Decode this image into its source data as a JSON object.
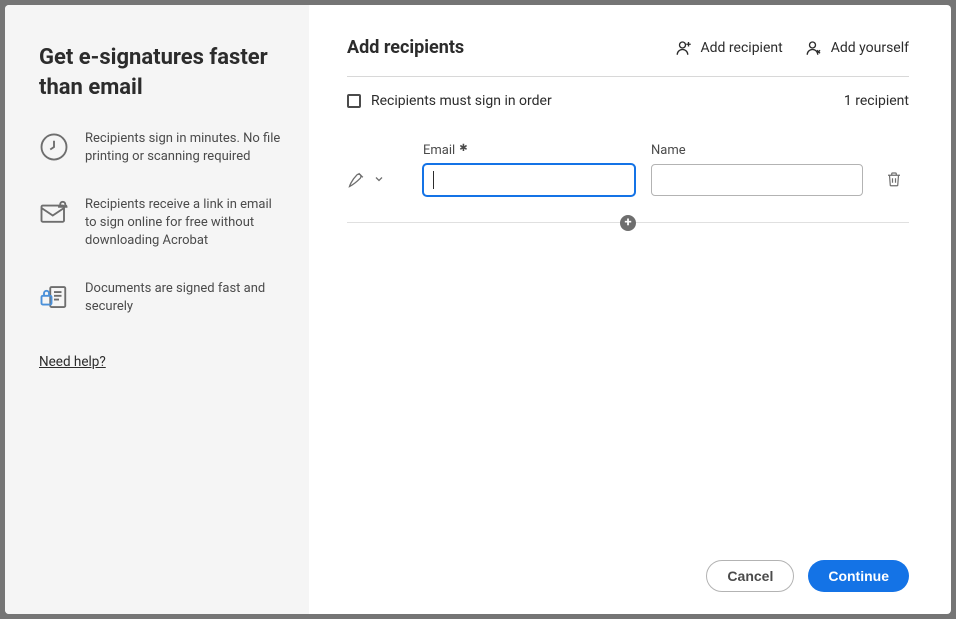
{
  "sidebar": {
    "title": "Get e-signatures faster than email",
    "features": [
      "Recipients sign in minutes. No file printing or scanning required",
      "Recipients receive a link in email to sign online for free without downloading Acrobat",
      "Documents are signed fast and securely"
    ],
    "help": "Need help?"
  },
  "main": {
    "title": "Add recipients",
    "add_recipient": "Add recipient",
    "add_yourself": "Add yourself",
    "sign_order_label": "Recipients must sign in order",
    "count_label": "1 recipient",
    "email_label": "Email",
    "name_label": "Name"
  },
  "footer": {
    "cancel": "Cancel",
    "continue": "Continue"
  }
}
